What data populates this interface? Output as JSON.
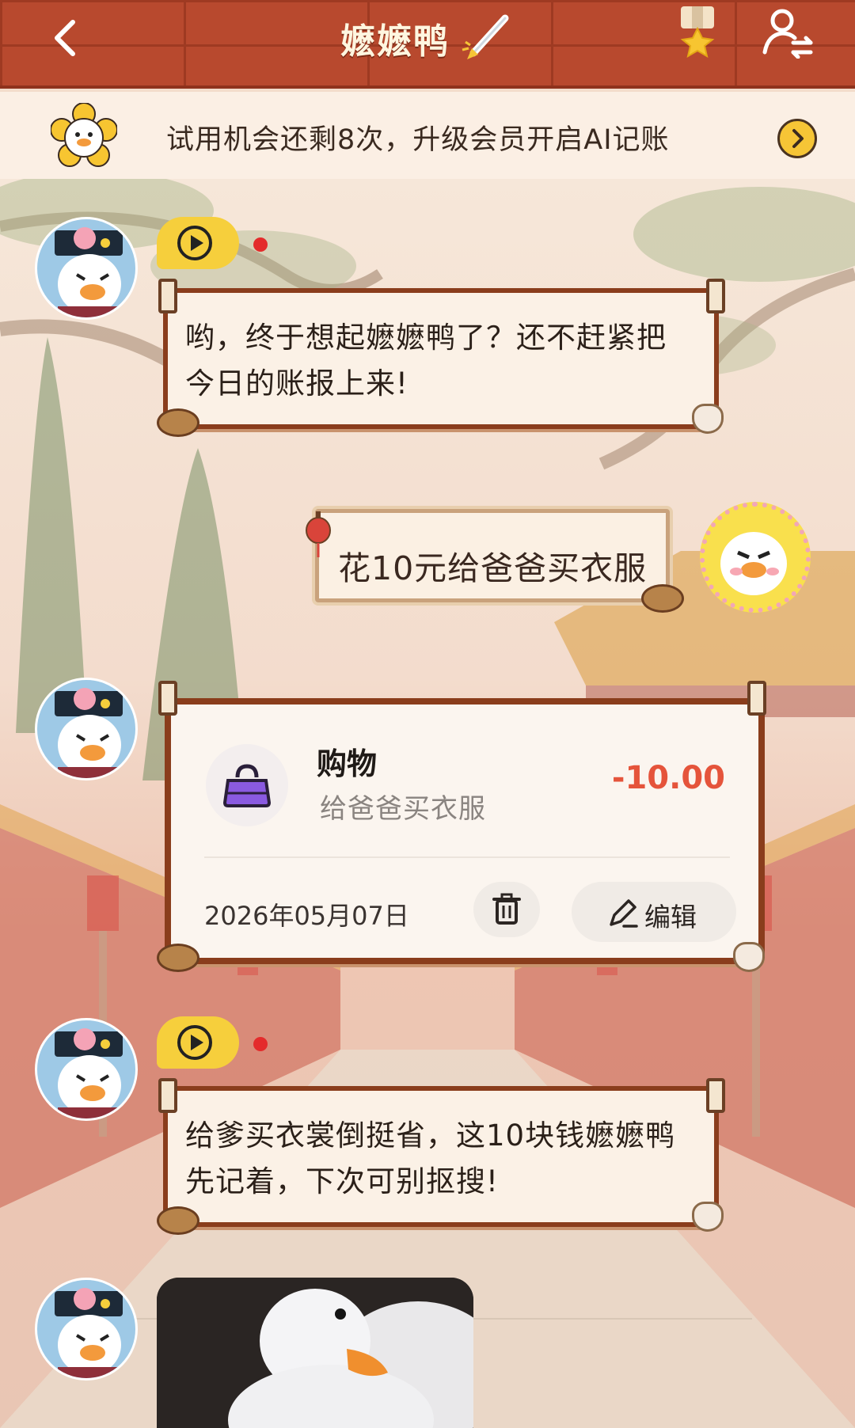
{
  "header": {
    "title": "嬷嬷鸭"
  },
  "banner": {
    "text": "试用机会还剩8次，升级会员开启AI记账"
  },
  "messages": {
    "bot_1": "哟，终于想起嬷嬷鸭了？还不赶紧把今日的账报上来!",
    "user_1": "花10元给爸爸买衣服",
    "bot_2": "给爹买衣裳倒挺省，这10块钱嬷嬷鸭先记着，下次可别抠搜!"
  },
  "record": {
    "category": "购物",
    "note": "给爸爸买衣服",
    "amount": "-10.00",
    "date": "2026年05月07日",
    "edit_label": "编辑"
  },
  "colors": {
    "header": "#b8492e",
    "scroll_border": "#8a3d1c",
    "accent_yellow": "#f6cf3c",
    "amount_red": "#e5543b"
  }
}
